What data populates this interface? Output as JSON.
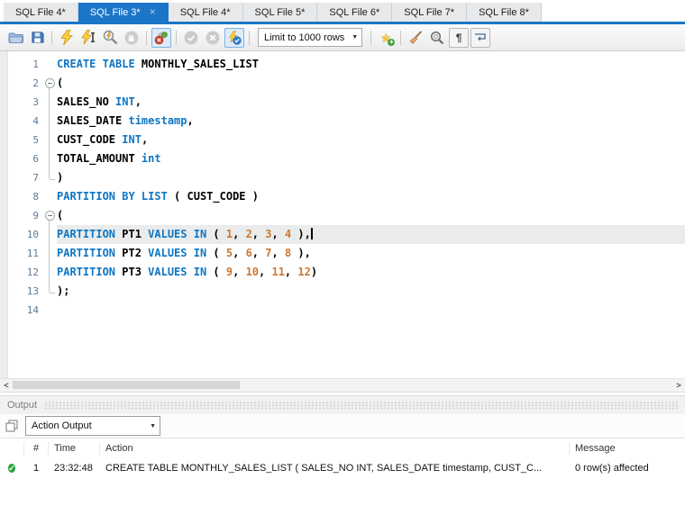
{
  "tab_bar": {
    "tabs": [
      {
        "label": "SQL File 4*",
        "active": false
      },
      {
        "label": "SQL File 3*",
        "active": true
      },
      {
        "label": "SQL File 4*",
        "active": false
      },
      {
        "label": "SQL File 5*",
        "active": false
      },
      {
        "label": "SQL File 6*",
        "active": false
      },
      {
        "label": "SQL File 7*",
        "active": false
      },
      {
        "label": "SQL File 8*",
        "active": false
      }
    ]
  },
  "glyphs": {
    "close": "×",
    "dropdown_caret": "▼",
    "check": "✓",
    "pilcrow": "¶",
    "star": "★",
    "plus": "+",
    "scroll_left": "<",
    "scroll_right": ">"
  },
  "toolbar": {
    "limit_dropdown_value": "Limit to 1000 rows",
    "items": [
      "open-file",
      "save",
      "execute",
      "execute-current-statement",
      "explain-plan",
      "stop",
      "toggle-stop-on-error",
      "commit",
      "rollback",
      "toggle-autocommit",
      "limit-rows-dropdown",
      "save-snippet",
      "beautify",
      "find",
      "show-invisibles",
      "wrap-text"
    ]
  },
  "editor": {
    "colors": {
      "keyword": "#0e76c4",
      "number": "#cc7832",
      "plain": "#000000",
      "line_number": "#5c7a99",
      "current_line_bg": "#e9eceb"
    },
    "lines": [
      {
        "num": "1",
        "fold": "none",
        "current": false,
        "segments": [
          {
            "t": "CREATE TABLE",
            "c": "kw"
          },
          {
            "t": " MONTHLY_SALES_LIST",
            "c": "pl"
          }
        ]
      },
      {
        "num": "2",
        "fold": "start",
        "current": false,
        "segments": [
          {
            "t": "(",
            "c": "pl"
          }
        ]
      },
      {
        "num": "3",
        "fold": "mid",
        "current": false,
        "segments": [
          {
            "t": "SALES_NO ",
            "c": "pl"
          },
          {
            "t": "INT",
            "c": "kw"
          },
          {
            "t": ",",
            "c": "pl"
          }
        ]
      },
      {
        "num": "4",
        "fold": "mid",
        "current": false,
        "segments": [
          {
            "t": "SALES_DATE ",
            "c": "pl"
          },
          {
            "t": "timestamp",
            "c": "kw"
          },
          {
            "t": ",",
            "c": "pl"
          }
        ]
      },
      {
        "num": "5",
        "fold": "mid",
        "current": false,
        "segments": [
          {
            "t": "CUST_CODE ",
            "c": "pl"
          },
          {
            "t": "INT",
            "c": "kw"
          },
          {
            "t": ",",
            "c": "pl"
          }
        ]
      },
      {
        "num": "6",
        "fold": "mid",
        "current": false,
        "segments": [
          {
            "t": "TOTAL_AMOUNT ",
            "c": "pl"
          },
          {
            "t": "int",
            "c": "kw"
          }
        ]
      },
      {
        "num": "7",
        "fold": "end",
        "current": false,
        "segments": [
          {
            "t": ")",
            "c": "pl"
          }
        ]
      },
      {
        "num": "8",
        "fold": "none",
        "current": false,
        "segments": [
          {
            "t": "PARTITION BY LIST",
            "c": "kw"
          },
          {
            "t": " ( CUST_CODE )",
            "c": "pl"
          }
        ]
      },
      {
        "num": "9",
        "fold": "start",
        "current": false,
        "segments": [
          {
            "t": "(",
            "c": "pl"
          }
        ]
      },
      {
        "num": "10",
        "fold": "mid",
        "current": true,
        "cursor": true,
        "segments": [
          {
            "t": "PARTITION",
            "c": "kw"
          },
          {
            "t": " PT1 ",
            "c": "pl"
          },
          {
            "t": "VALUES IN",
            "c": "kw"
          },
          {
            "t": " ( ",
            "c": "pl"
          },
          {
            "t": "1",
            "c": "num"
          },
          {
            "t": ", ",
            "c": "pl"
          },
          {
            "t": "2",
            "c": "num"
          },
          {
            "t": ", ",
            "c": "pl"
          },
          {
            "t": "3",
            "c": "num"
          },
          {
            "t": ", ",
            "c": "pl"
          },
          {
            "t": "4",
            "c": "num"
          },
          {
            "t": " ),",
            "c": "pl"
          }
        ]
      },
      {
        "num": "11",
        "fold": "mid",
        "current": false,
        "segments": [
          {
            "t": "PARTITION",
            "c": "kw"
          },
          {
            "t": " PT2 ",
            "c": "pl"
          },
          {
            "t": "VALUES IN",
            "c": "kw"
          },
          {
            "t": " ( ",
            "c": "pl"
          },
          {
            "t": "5",
            "c": "num"
          },
          {
            "t": ", ",
            "c": "pl"
          },
          {
            "t": "6",
            "c": "num"
          },
          {
            "t": ", ",
            "c": "pl"
          },
          {
            "t": "7",
            "c": "num"
          },
          {
            "t": ", ",
            "c": "pl"
          },
          {
            "t": "8",
            "c": "num"
          },
          {
            "t": " ),",
            "c": "pl"
          }
        ]
      },
      {
        "num": "12",
        "fold": "mid",
        "current": false,
        "segments": [
          {
            "t": "PARTITION",
            "c": "kw"
          },
          {
            "t": " PT3 ",
            "c": "pl"
          },
          {
            "t": "VALUES IN",
            "c": "kw"
          },
          {
            "t": " ( ",
            "c": "pl"
          },
          {
            "t": "9",
            "c": "num"
          },
          {
            "t": ", ",
            "c": "pl"
          },
          {
            "t": "10",
            "c": "num"
          },
          {
            "t": ", ",
            "c": "pl"
          },
          {
            "t": "11",
            "c": "num"
          },
          {
            "t": ", ",
            "c": "pl"
          },
          {
            "t": "12",
            "c": "num"
          },
          {
            "t": ")",
            "c": "pl"
          }
        ]
      },
      {
        "num": "13",
        "fold": "end",
        "current": false,
        "segments": [
          {
            "t": ");",
            "c": "pl"
          }
        ]
      },
      {
        "num": "14",
        "fold": "none",
        "current": false,
        "segments": []
      }
    ]
  },
  "output": {
    "title": "Output",
    "view_selector": "Action Output",
    "table": {
      "headers": [
        "#",
        "Time",
        "Action",
        "Message"
      ],
      "rows": [
        {
          "status": "success",
          "num": "1",
          "time": "23:32:48",
          "action": "CREATE TABLE MONTHLY_SALES_LIST ( SALES_NO INT, SALES_DATE timestamp, CUST_C...",
          "message": "0 row(s) affected"
        }
      ]
    }
  }
}
